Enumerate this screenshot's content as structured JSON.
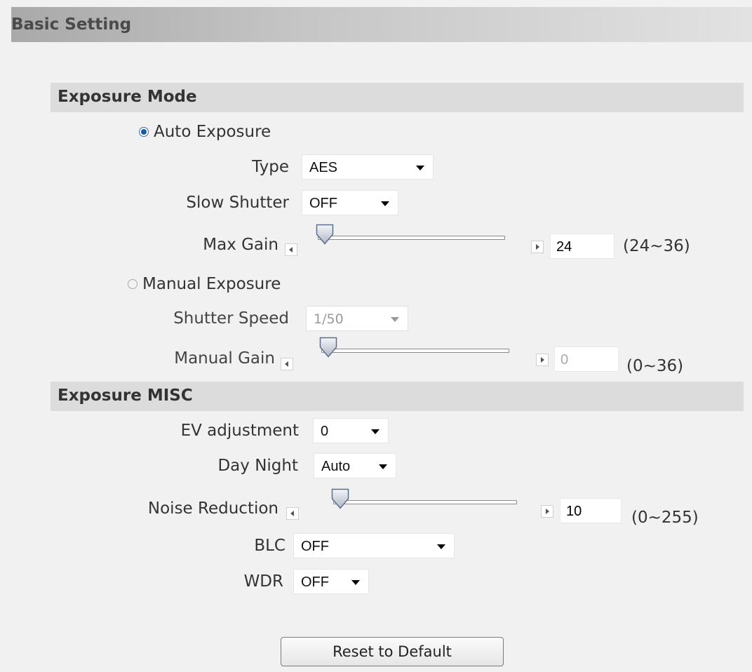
{
  "header": {
    "title": "Basic Setting"
  },
  "exposure_mode": {
    "section_title": "Exposure Mode",
    "auto": {
      "radio_label": "Auto Exposure",
      "selected": true,
      "type_label": "Type",
      "type_value": "AES",
      "slow_shutter_label": "Slow Shutter",
      "slow_shutter_value": "OFF",
      "max_gain_label": "Max Gain",
      "max_gain_value": "24",
      "max_gain_range": "(24~36)"
    },
    "manual": {
      "radio_label": "Manual Exposure",
      "selected": false,
      "shutter_speed_label": "Shutter Speed",
      "shutter_speed_value": "1/50",
      "manual_gain_label": "Manual Gain",
      "manual_gain_value": "0",
      "manual_gain_range": "(0~36)"
    }
  },
  "exposure_misc": {
    "section_title": "Exposure MISC",
    "ev_label": "EV adjustment",
    "ev_value": "0",
    "day_night_label": "Day Night",
    "day_night_value": "Auto",
    "noise_reduction_label": "Noise Reduction",
    "noise_reduction_value": "10",
    "noise_reduction_range": "(0~255)",
    "blc_label": "BLC",
    "blc_value": "OFF",
    "wdr_label": "WDR",
    "wdr_value": "OFF"
  },
  "reset_button": {
    "label": "Reset to Default"
  },
  "colors": {
    "accent": "#1e5aa3",
    "section_bg": "#dcdcdc",
    "page_bg": "#f1f1f1"
  }
}
